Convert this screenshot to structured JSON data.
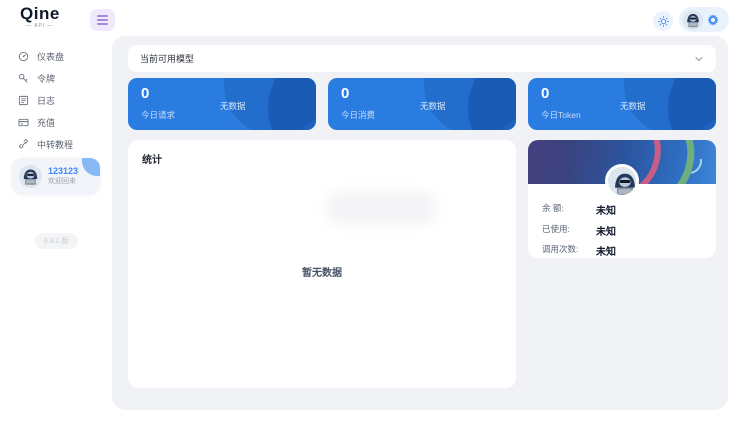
{
  "app": {
    "logo_text": "Qine",
    "logo_sub": "— API —",
    "version_badge": "0.9.2 版"
  },
  "topbar": {
    "icons": {
      "menu": "hamburger-icon",
      "theme": "sun-icon",
      "settings": "gear-icon",
      "avatar": "hacker-avatar"
    }
  },
  "sidebar": {
    "items": [
      {
        "label": "仪表盘",
        "icon": "gauge-icon"
      },
      {
        "label": "令牌",
        "icon": "key-icon"
      },
      {
        "label": "日志",
        "icon": "log-icon"
      },
      {
        "label": "充值",
        "icon": "recharge-card-icon"
      },
      {
        "label": "中转教程",
        "icon": "link-icon"
      }
    ],
    "user": {
      "name": "123123",
      "greeting": "欢迎回来"
    }
  },
  "main": {
    "model_panel": {
      "title": "当前可用模型",
      "chevron": "chevron-down-icon"
    },
    "stat_cards": [
      {
        "value": "0",
        "label": "今日请求",
        "empty": "无数据"
      },
      {
        "value": "0",
        "label": "今日消费",
        "empty": "无数据"
      },
      {
        "value": "0",
        "label": "今日Token",
        "empty": "无数据"
      }
    ],
    "stats_panel": {
      "title": "统计",
      "empty_text": "暂无数据"
    },
    "account_card": {
      "rows": [
        {
          "label": "余 额:",
          "value": "未知"
        },
        {
          "label": "已使用:",
          "value": "未知"
        },
        {
          "label": "调用次数:",
          "value": "未知"
        }
      ]
    }
  },
  "colors": {
    "accent_blue": "#2b7ce1",
    "link_blue": "#4285f4",
    "menu_purple": "#a489d8",
    "container_gray": "#f0f2f5"
  }
}
